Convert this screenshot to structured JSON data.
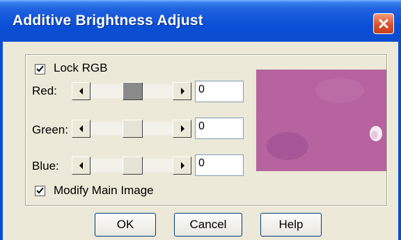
{
  "window": {
    "title": "Additive Brightness Adjust"
  },
  "lock_rgb": {
    "label": "Lock RGB",
    "checked": true
  },
  "channels": [
    {
      "label": "Red:",
      "value": "0"
    },
    {
      "label": "Green:",
      "value": "0"
    },
    {
      "label": "Blue:",
      "value": "0"
    }
  ],
  "modify_main": {
    "label": "Modify Main Image",
    "checked": true
  },
  "buttons": {
    "ok": "OK",
    "cancel": "Cancel",
    "help": "Help"
  },
  "colors": {
    "titlebar": "#0a4ed6",
    "dialog_bg": "#ece9d8",
    "preview_tissue": "#b8609a"
  },
  "icons": {
    "close": "close-icon",
    "left_arrow": "left-arrow-icon",
    "right_arrow": "right-arrow-icon",
    "check": "checkmark-icon"
  }
}
